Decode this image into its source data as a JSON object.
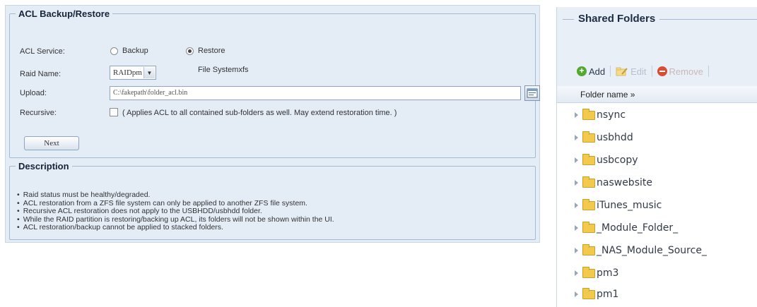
{
  "acl_panel": {
    "title": "ACL Backup/Restore",
    "service_label": "ACL Service:",
    "option_backup": "Backup",
    "option_restore": "Restore",
    "selected_option": "Restore",
    "raid_label": "Raid Name:",
    "raid_value": "RAIDpm",
    "filesystem_text": "File Systemxfs",
    "upload_label": "Upload:",
    "upload_value": "C:\\fakepath\\folder_acl.bin",
    "recursive_label": "Recursive:",
    "recursive_checked": false,
    "recursive_note": "( Applies ACL to all contained sub-folders as well. May extend restoration time. )",
    "next_label": "Next"
  },
  "description": {
    "title": "Description",
    "items": [
      "Raid status must be healthy/degraded.",
      "ACL restoration from a ZFS file system can only be applied to another ZFS file system.",
      "Recursive ACL restoration does not apply to the USBHDD/usbhdd folder.",
      "While the RAID partition is restoring/backing up ACL, its folders will not be shown within the UI.",
      "ACL restoration/backup cannot be applied to stacked folders."
    ]
  },
  "shared_folders": {
    "title": "Shared Folders",
    "toolbar": {
      "add": "Add",
      "edit": "Edit",
      "remove": "Remove"
    },
    "column_header": "Folder name »",
    "folders": [
      "nsync",
      "usbhdd",
      "usbcopy",
      "naswebsite",
      "iTunes_music",
      "_Module_Folder_",
      "_NAS_Module_Source_",
      "pm3",
      "pm1"
    ]
  },
  "colors": {
    "panel_bg": "#e4ecf6",
    "border": "#a5b9d2",
    "folder_yellow": "#f2c94c",
    "add_green": "#55a832",
    "remove_red": "#d94d33"
  },
  "icons": [
    "radio-icon",
    "dropdown-arrow-icon",
    "browse-file-icon",
    "checkbox-icon",
    "add-icon",
    "edit-icon",
    "remove-icon",
    "expander-icon",
    "folder-icon"
  ]
}
